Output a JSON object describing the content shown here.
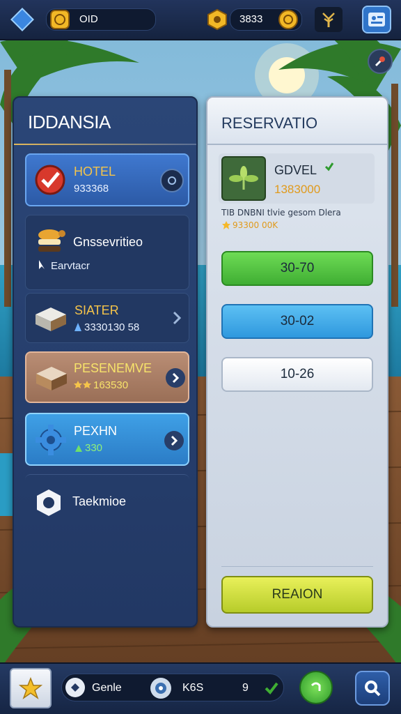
{
  "top_bar": {
    "player_label": "OID",
    "currency_value": "3833"
  },
  "left_panel": {
    "title": "IDDANSIA",
    "items": [
      {
        "name": "HOTEL",
        "value": "933368"
      },
      {
        "name": "Gnssevritieo",
        "value": "Earvtacr"
      },
      {
        "name": "SIATER",
        "value": "3330130 58"
      },
      {
        "name": "PESENEMVE",
        "value": "163530"
      },
      {
        "name": "PEXHN",
        "value": "330"
      },
      {
        "name": "Taekmioe",
        "value": ""
      }
    ]
  },
  "right_panel": {
    "title": "RESERVATIO",
    "selected": {
      "name": "GDVEL",
      "price": "1383000",
      "description": "TIB DNBNI tlvie gesom Dlera",
      "rating_value": "93300 00K"
    },
    "options": [
      "30-70",
      "30-02",
      "10-26"
    ],
    "confirm_label": "REAION"
  },
  "bottom_bar": {
    "label_a": "Genle",
    "label_b": "K6S",
    "count": "9"
  },
  "colors": {
    "panel_dark": "#243a66",
    "accent_gold": "#f2c94c",
    "option_green": "#52c041",
    "option_blue": "#3aa7e6",
    "confirm_yellow": "#c7d83a"
  }
}
